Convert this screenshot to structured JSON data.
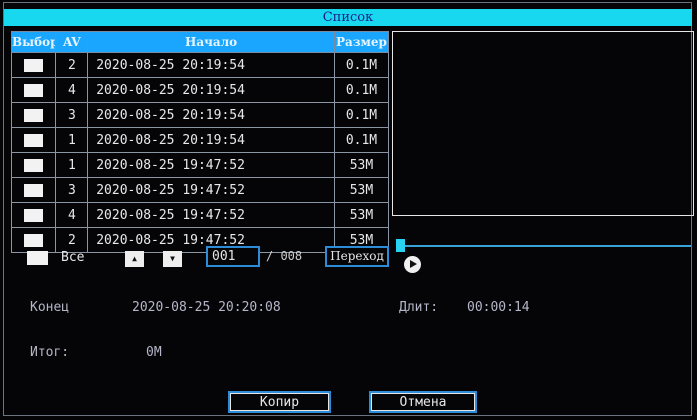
{
  "title": "Список",
  "table": {
    "headers": [
      "Выбор",
      "AV",
      "Начало",
      "Размер"
    ],
    "rows": [
      {
        "av": "2",
        "start": "2020-08-25 20:19:54",
        "size": "0.1M"
      },
      {
        "av": "4",
        "start": "2020-08-25 20:19:54",
        "size": "0.1M"
      },
      {
        "av": "3",
        "start": "2020-08-25 20:19:54",
        "size": "0.1M"
      },
      {
        "av": "1",
        "start": "2020-08-25 20:19:54",
        "size": "0.1M"
      },
      {
        "av": "1",
        "start": "2020-08-25 19:47:52",
        "size": "53M"
      },
      {
        "av": "3",
        "start": "2020-08-25 19:47:52",
        "size": "53M"
      },
      {
        "av": "4",
        "start": "2020-08-25 19:47:52",
        "size": "53M"
      },
      {
        "av": "2",
        "start": "2020-08-25 19:47:52",
        "size": "53M"
      }
    ]
  },
  "controls": {
    "all_label": "Все",
    "up_icon": "arrow-up-icon",
    "down_icon": "arrow-down-icon",
    "page": "001",
    "page_total": "/ 008",
    "goto": "Переход"
  },
  "info": {
    "end_label": "Конец",
    "end_value": "2020-08-25 20:20:08",
    "duration_label": "Длит:",
    "duration_value": "00:00:14",
    "total_label": "Итог:",
    "total_value": "0M"
  },
  "buttons": {
    "copy": "Копир",
    "cancel": "Отмена"
  },
  "colors": {
    "title_bar": "#18d8f0",
    "header": "#1aa6ff",
    "button_border": "#2c8cd8"
  }
}
